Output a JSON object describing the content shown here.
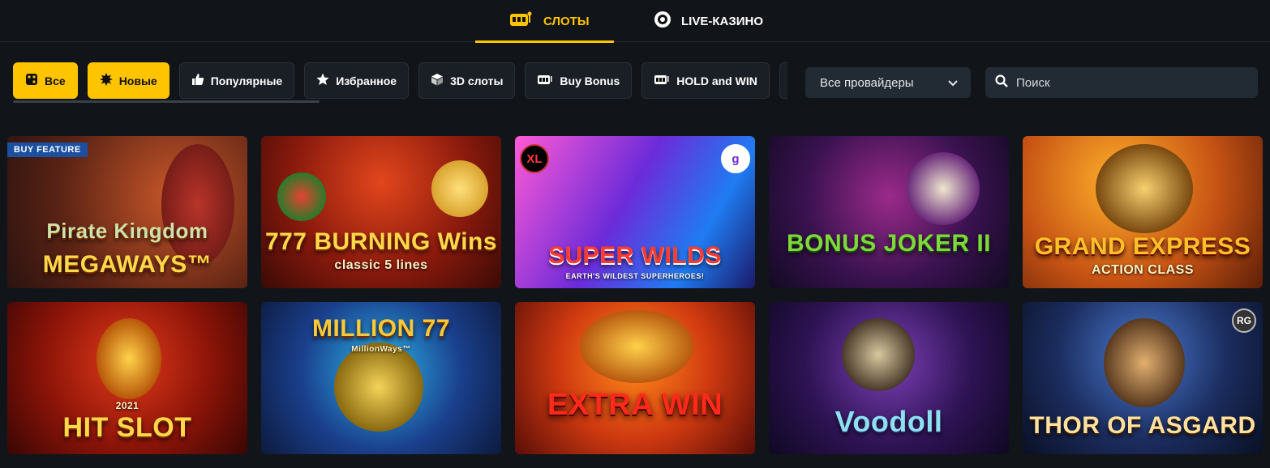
{
  "top_tabs": [
    {
      "label": "СЛОТЫ",
      "icon": "slot-machine-icon",
      "active": true
    },
    {
      "label": "LIVE-КАЗИНО",
      "icon": "casino-chip-icon",
      "active": false
    }
  ],
  "filters": [
    {
      "label": "Все",
      "icon": "dice-icon",
      "active": true
    },
    {
      "label": "Новые",
      "icon": "burst-icon",
      "active": true
    },
    {
      "label": "Популярные",
      "icon": "thumbs-up-icon",
      "active": false
    },
    {
      "label": "Избранное",
      "icon": "star-icon",
      "active": false
    },
    {
      "label": "3D слоты",
      "icon": "cube-icon",
      "active": false
    },
    {
      "label": "Buy Bonus",
      "icon": "slot-machine-icon",
      "active": false
    },
    {
      "label": "HOLD and WIN",
      "icon": "slot-machine-icon",
      "active": false
    }
  ],
  "provider_select": {
    "value": "Все провайдеры"
  },
  "search": {
    "placeholder": "Поиск"
  },
  "games": [
    {
      "title": "Pirate Kingdom",
      "subtitle": "MEGAWAYS™",
      "badge": "BUY FEATURE",
      "logo": ""
    },
    {
      "title": "777 BURNING Wins",
      "subtitle": "classic 5 lines",
      "badge": "",
      "logo": ""
    },
    {
      "title": "SUPER WILDS",
      "subtitle": "EARTH'S WILDEST SUPERHEROES!",
      "badge": "",
      "logo": "XL",
      "logo2": "g"
    },
    {
      "title": "BONUS JOKER II",
      "subtitle": "",
      "badge": "",
      "logo": ""
    },
    {
      "title": "GRAND EXPRESS",
      "subtitle": "ACTION CLASS",
      "badge": "",
      "logo": ""
    },
    {
      "title": "HIT SLOT",
      "subtitle": "2021",
      "badge": "",
      "logo": ""
    },
    {
      "title": "MILLION 77",
      "subtitle": "MillionWays™",
      "badge": "",
      "logo": ""
    },
    {
      "title": "EXTRA WIN",
      "subtitle": "",
      "badge": "",
      "logo": ""
    },
    {
      "title": "Voodoll",
      "subtitle": "",
      "badge": "",
      "logo": ""
    },
    {
      "title": "THOR OF ASGARD",
      "subtitle": "",
      "badge": "",
      "logo": "RG"
    }
  ],
  "colors": {
    "accent": "#ffc400",
    "background": "#111519",
    "chip": "#1a1f26",
    "input": "#222a34"
  }
}
